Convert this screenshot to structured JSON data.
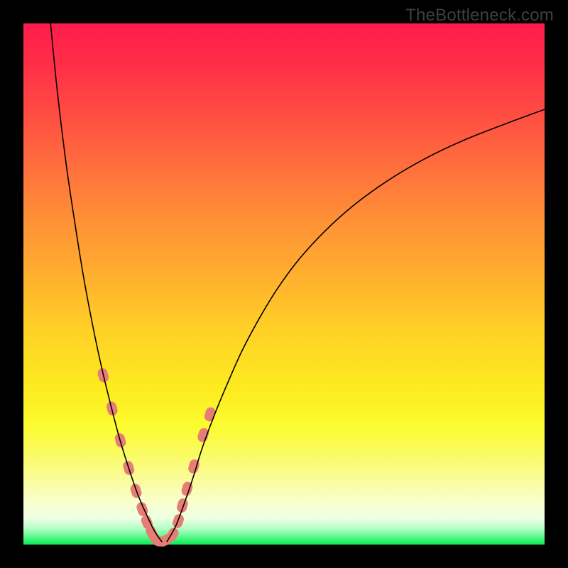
{
  "watermark": "TheBottleneck.com",
  "colors": {
    "black": "#000000",
    "curve": "#000000",
    "dot": "#e77e75",
    "gradient_top": "#ff1b4c",
    "gradient_bottom": "#09ed56"
  },
  "chart_data": {
    "type": "line",
    "title": "",
    "xlabel": "",
    "ylabel": "",
    "xlim": [
      0,
      100
    ],
    "ylim": [
      0,
      100
    ],
    "grid": false,
    "note": "x and y are percentages of the plot area; y is measured from the bottom (0 = green zone, 100 = red top). The two curves form a V-shape with a flat minimum near x≈25–28.",
    "series": [
      {
        "name": "left-branch",
        "x": [
          5.2,
          6.5,
          8.2,
          9.9,
          11.6,
          13.3,
          15.0,
          16.7,
          18.4,
          20.1,
          21.8,
          23.5,
          25.2,
          26.6
        ],
        "y": [
          100,
          87,
          73,
          61.5,
          51,
          42,
          34,
          27,
          20.5,
          15,
          10,
          6,
          2.5,
          0.5
        ]
      },
      {
        "name": "right-branch",
        "x": [
          27.5,
          29.2,
          30.9,
          32.6,
          34.3,
          36.7,
          39.4,
          42.1,
          45.6,
          49.0,
          53.1,
          58.0,
          63.5,
          69.7,
          76.6,
          84.3,
          92.7,
          100.0
        ],
        "y": [
          0.5,
          3.5,
          8,
          13,
          18.5,
          25,
          31.5,
          37.5,
          44,
          49.5,
          55,
          60.3,
          65.2,
          69.7,
          73.8,
          77.5,
          80.8,
          83.5
        ]
      }
    ],
    "dots": {
      "name": "highlighted-points",
      "note": "Pink rounded markers near the minimum on both branches",
      "x": [
        15.3,
        17.0,
        18.6,
        20.2,
        21.6,
        22.8,
        23.7,
        24.6,
        25.4,
        26.3,
        27.4,
        28.6,
        29.7,
        30.5,
        31.4,
        32.7,
        34.5,
        35.8
      ],
      "y": [
        32.5,
        26.1,
        20.0,
        14.7,
        10.3,
        6.8,
        4.3,
        2.3,
        1.0,
        0.6,
        0.9,
        1.9,
        4.5,
        7.5,
        10.7,
        15.0,
        21.0,
        25.0
      ]
    }
  }
}
